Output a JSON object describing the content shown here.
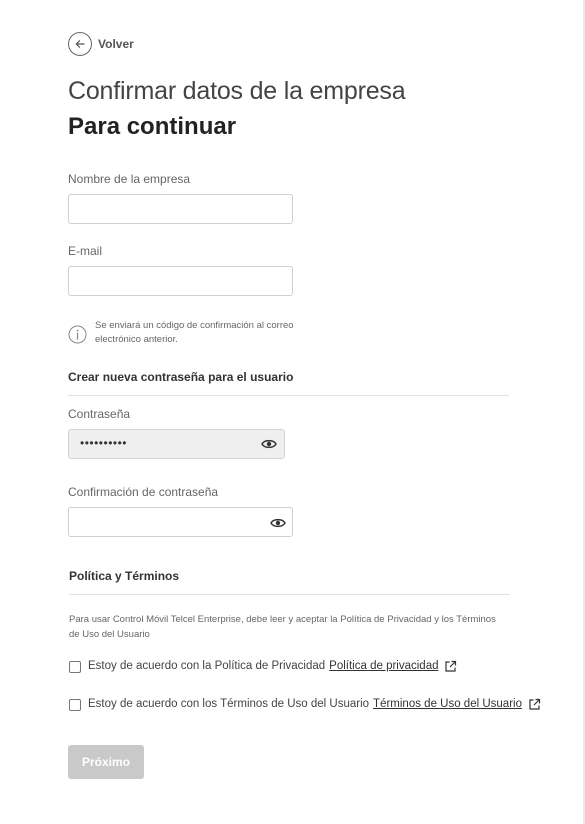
{
  "nav": {
    "back_label": "Volver"
  },
  "header": {
    "title": "Confirmar datos de la empresa",
    "subtitle": "Para continuar"
  },
  "form": {
    "company_name": {
      "label": "Nombre de la empresa",
      "value": ""
    },
    "email": {
      "label": "E-mail",
      "value": ""
    },
    "info_text": "Se enviará un código de confirmación al correo electrónico anterior."
  },
  "password_section": {
    "title": "Crear nueva contraseña para el usuario",
    "password": {
      "label": "Contraseña",
      "masked_value": "••••••••••"
    },
    "confirm": {
      "label": "Confirmación de contraseña",
      "value": ""
    }
  },
  "policy": {
    "title": "Política y Términos",
    "description": "Para usar Control Móvil Telcel Enterprise, debe leer y aceptar la Política de Privacidad y los Términos de Uso del Usuario",
    "privacy": {
      "text": "Estoy de acuerdo con la Política de Privacidad",
      "link": "Política de privacidad",
      "checked": false
    },
    "terms": {
      "text": "Estoy de acuerdo con los Términos de Uso del Usuario",
      "link": "Términos de Uso del Usuario",
      "checked": false
    }
  },
  "actions": {
    "next_label": "Próximo",
    "next_enabled": false
  },
  "colors": {
    "text_primary": "#222222",
    "text_secondary": "#666666",
    "button_disabled": "#c9c9c9",
    "input_disabled": "#efefef"
  }
}
